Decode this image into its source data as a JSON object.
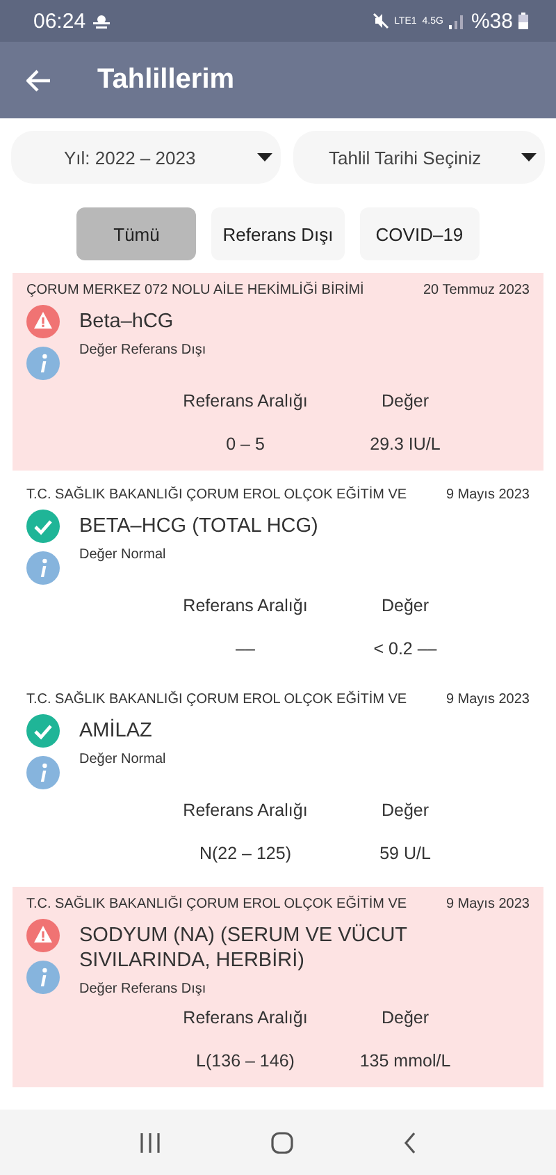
{
  "status_bar": {
    "time": "06:24",
    "network": [
      "LTE1",
      "4.5G"
    ],
    "battery": "%38"
  },
  "app_bar": {
    "title": "Tahlillerim"
  },
  "dropdowns": [
    {
      "label": "Yıl: 2022 – 2023"
    },
    {
      "label": "Tahlil Tarihi Seçiniz"
    }
  ],
  "filters": [
    {
      "label": "Tümü",
      "selected": true
    },
    {
      "label": "Referans Dışı",
      "selected": false
    },
    {
      "label": "COVID–19",
      "selected": false
    }
  ],
  "results": [
    {
      "kind": "out_of_range",
      "source": "ÇORUM MERKEZ 072 NOLU AİLE HEKİMLİĞİ BİRİMİ",
      "date": "20 Temmuz 2023",
      "test": "Beta–hCG",
      "status": "Değer Referans Dışı",
      "range_label": "Referans Aralığı",
      "value_label": "Değer",
      "range": "0 – 5",
      "value": "29.3 IU/L"
    },
    {
      "kind": "normal",
      "source": "T.C. SAĞLIK BAKANLIĞI ÇORUM EROL OLÇOK EĞİTİM VE",
      "date": "9 Mayıs 2023",
      "test": "BETA–HCG (TOTAL HCG)",
      "status": "Değer Normal",
      "range_label": "Referans Aralığı",
      "value_label": "Değer",
      "range": "––",
      "value": "< 0.2 ––"
    },
    {
      "kind": "normal",
      "source": "T.C. SAĞLIK BAKANLIĞI ÇORUM EROL OLÇOK EĞİTİM VE",
      "date": "9 Mayıs 2023",
      "test": "AMİLAZ",
      "status": "Değer Normal",
      "range_label": "Referans Aralığı",
      "value_label": "Değer",
      "range": "N(22 – 125)",
      "value": "59 U/L"
    },
    {
      "kind": "out_of_range",
      "source": "T.C. SAĞLIK BAKANLIĞI ÇORUM EROL OLÇOK EĞİTİM VE",
      "date": "9 Mayıs 2023",
      "test": "SODYUM (NA) (SERUM VE VÜCUT SIVILARINDA, HERBİRİ)",
      "status": "Değer Referans Dışı",
      "range_label": "Referans Aralığı",
      "value_label": "Değer",
      "range": "L(136 – 146)",
      "value": "135 mmol/L"
    }
  ]
}
